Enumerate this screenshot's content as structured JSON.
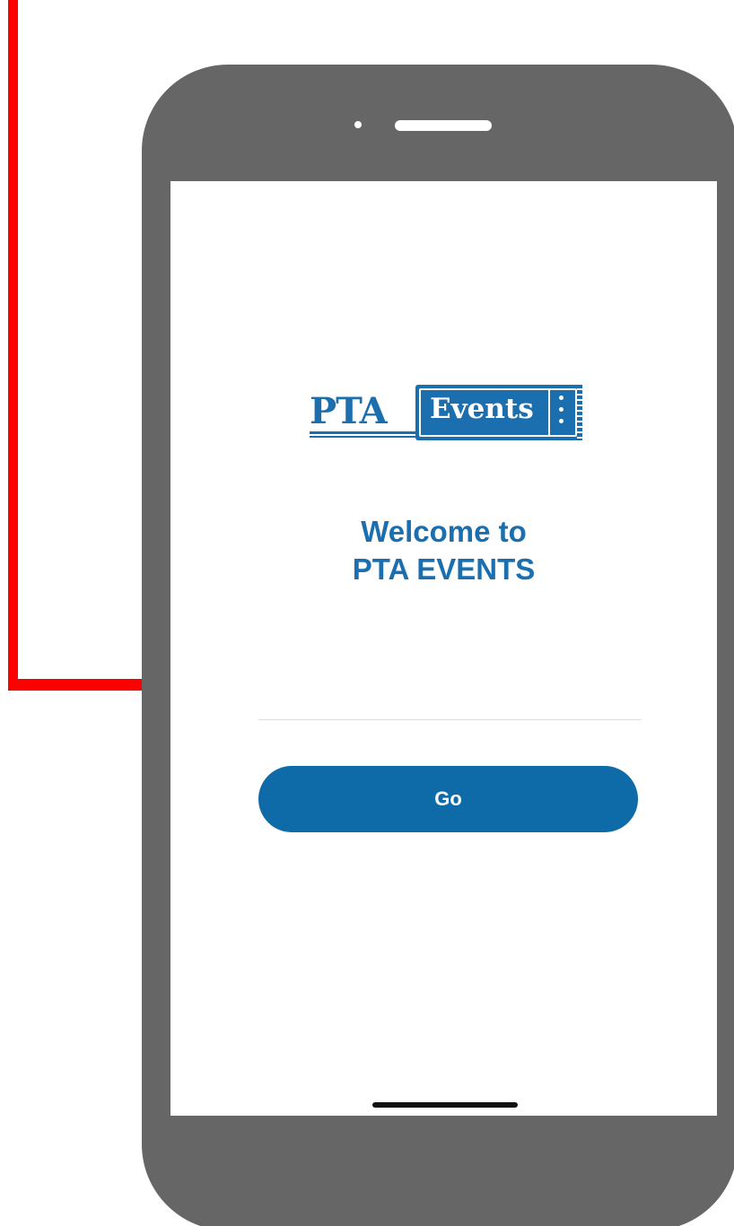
{
  "logo": {
    "pta": "PTA",
    "events": "Events"
  },
  "welcome": {
    "line1": "Welcome to",
    "line2": "PTA EVENTS"
  },
  "input": {
    "value": "",
    "placeholder": ""
  },
  "go_button": {
    "label": "Go"
  },
  "colors": {
    "brand_blue": "#1c6fae",
    "button_blue": "#0f6aa8",
    "phone_gray": "#666666",
    "annotation_red": "#ff0000"
  }
}
